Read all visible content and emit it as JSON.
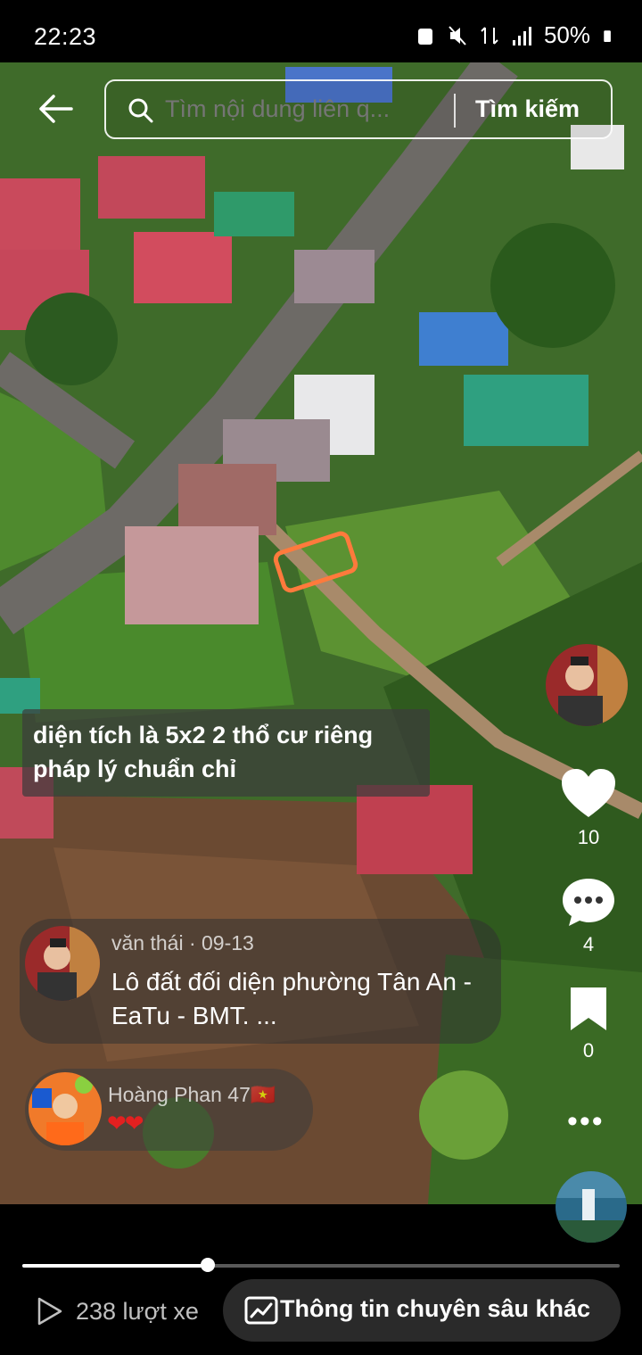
{
  "status_bar": {
    "time": "22:23",
    "battery": "50%"
  },
  "search": {
    "placeholder": "Tìm nội dung liên q...",
    "button_label": "Tìm kiếm"
  },
  "caption": {
    "line1": "diện tích là 5x2 2 thổ cư riêng",
    "line2": "pháp lý chuẩn chỉ"
  },
  "comments": [
    {
      "author": "văn thái",
      "date": "09-13",
      "text": "Lô đất đối diện phường Tân An - EaTu - BMT. ..."
    },
    {
      "author": "Hoàng Phan 47",
      "flag": "🇻🇳",
      "text": "❤❤"
    }
  ],
  "actions": {
    "likes": "10",
    "comments": "4",
    "saves": "0"
  },
  "icons": [
    "back-arrow-icon",
    "search-icon",
    "heart-icon",
    "comment-icon",
    "bookmark-icon",
    "more-icon",
    "play-icon",
    "chart-icon"
  ],
  "progress": {
    "fraction": 0.31
  },
  "footer": {
    "views": "238 lượt xe",
    "insight_label": "Thông tin chuyên sâu khác"
  },
  "colors": {
    "accent": "#ffffff",
    "insight_bg": "#2a2a2a",
    "heart_red": "#e32020",
    "highlight": "#ff7a3c"
  }
}
